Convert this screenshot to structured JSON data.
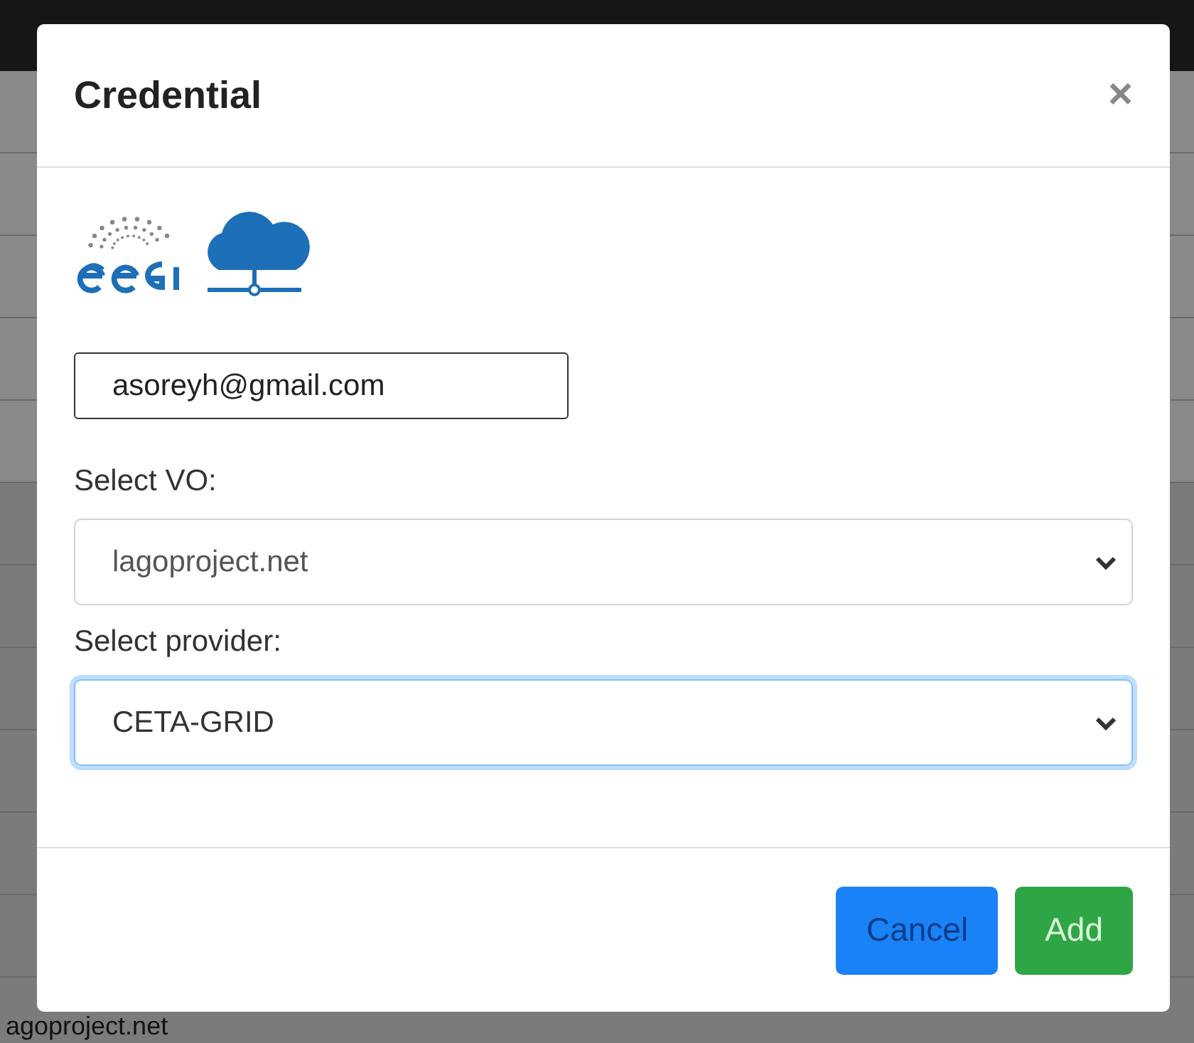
{
  "background": {
    "footer_text": "agoproject.net"
  },
  "modal": {
    "title": "Credential",
    "close": "×",
    "email": {
      "value": "asoreyh@gmail.com"
    },
    "vo": {
      "label": "Select VO:",
      "value": "lagoproject.net",
      "focused": false
    },
    "provider": {
      "label": "Select provider:",
      "value": "CETA-GRID",
      "focused": true
    },
    "buttons": [
      {
        "label": "Cancel",
        "kind": "primary"
      },
      {
        "label": "Add",
        "kind": "success"
      }
    ]
  }
}
